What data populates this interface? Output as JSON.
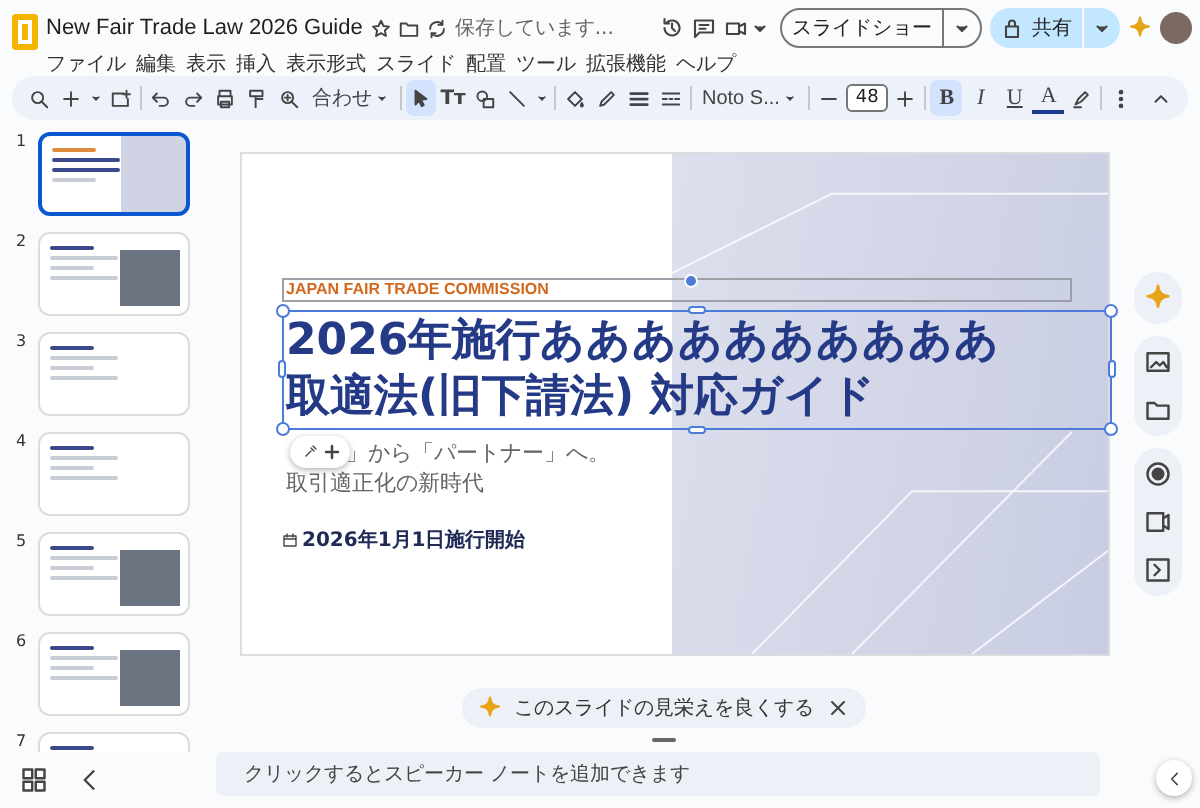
{
  "document": {
    "title": "New Fair Trade Law 2026 Guide",
    "save_status": "保存しています..."
  },
  "menu": [
    "ファイル",
    "編集",
    "表示",
    "挿入",
    "表示形式",
    "スライド",
    "配置",
    "ツール",
    "拡張機能",
    "ヘルプ"
  ],
  "buttons": {
    "slideshow": "スライドショー",
    "share": "共有"
  },
  "toolbar": {
    "zoom": "合わせ",
    "tools": [
      {
        "selected": true
      },
      {
        "label": "Tт",
        "selected": false
      },
      {
        "selected": false
      },
      {
        "selected": false
      }
    ],
    "font": "Noto S...",
    "font_size": "48",
    "format": [
      {
        "label": "B",
        "selected": true
      },
      {
        "label": "I",
        "selected": false
      },
      {
        "label": "U",
        "selected": false
      },
      {
        "label": "A",
        "selected": false
      }
    ]
  },
  "slides": [
    {
      "number": "1",
      "selected": true
    },
    {
      "number": "2",
      "selected": false
    },
    {
      "number": "3",
      "selected": false
    },
    {
      "number": "4",
      "selected": false
    },
    {
      "number": "5",
      "selected": false
    },
    {
      "number": "6",
      "selected": false
    },
    {
      "number": "7",
      "selected": false
    }
  ],
  "slide": {
    "kicker": "JAPAN FAIR TRADE COMMISSION",
    "title_lines": [
      "2026年施行ああああああああああ",
      "取適法(旧下請法) 対応ガイド"
    ],
    "subtitle_lines": [
      "」から「パートナー」へ。",
      "取引適正化の新時代"
    ],
    "date": "2026年1月1日施行開始"
  },
  "suggestion": "このスライドの見栄えを良くする",
  "notes": {
    "placeholder": "クリックするとスピーカー ノートを追加できます"
  }
}
